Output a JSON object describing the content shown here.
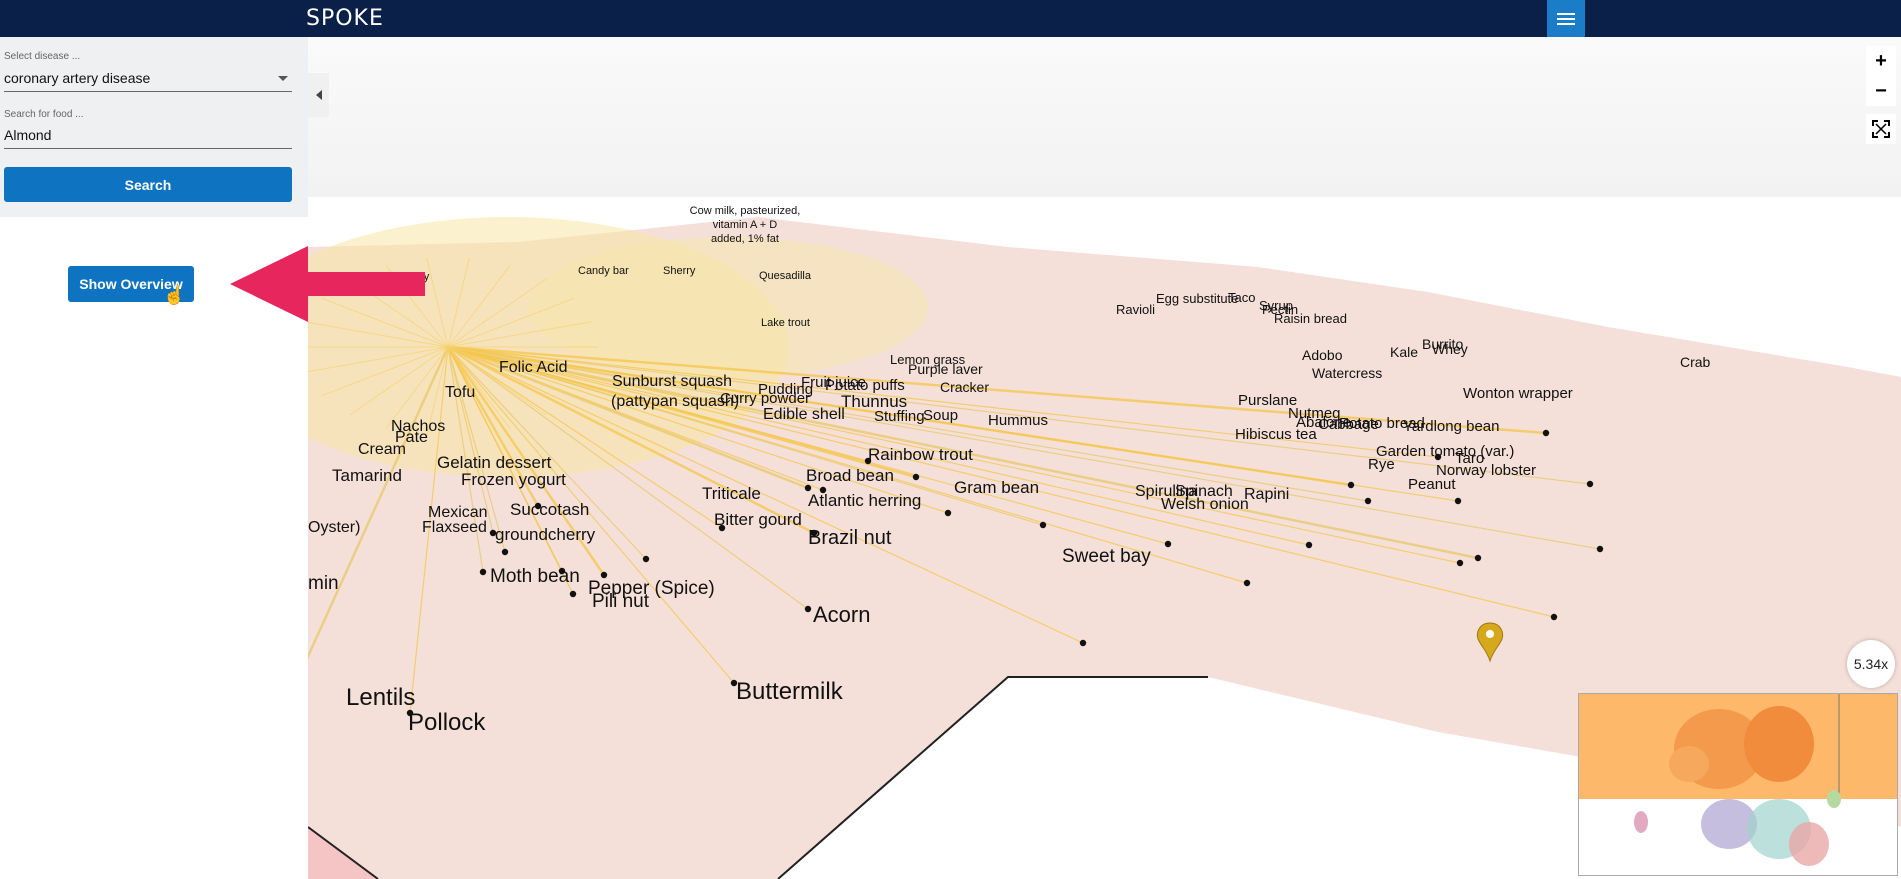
{
  "app": {
    "logo_text": "SPOKE"
  },
  "topbar": {
    "menu_icon": "hamburger-icon"
  },
  "sidebar": {
    "disease_label": "Select disease ...",
    "disease_value": "coronary artery disease",
    "food_label": "Search for food ...",
    "food_value": "Almond",
    "search_button": "Search",
    "overview_button": "Show Overview"
  },
  "map": {
    "zoom_in": "+",
    "zoom_out": "−",
    "zoom_level": "5.34x",
    "top_label_lines": [
      "Cow milk, pasteurized,",
      "vitamin A + D",
      "added, 1% fat"
    ],
    "large_labels": [
      "Lentils",
      "Pollock",
      "Buttermilk",
      "Acorn",
      "Brazil nut",
      "Sweet bay",
      "Moth bean",
      "Pepper (Spice)",
      "Pili nut",
      "groundcherry",
      "Bitter gourd",
      "Atlantic herring",
      "Broad bean",
      "Gram bean",
      "Spirulina",
      "Spinach",
      "Welsh onion",
      "Rapini",
      "Edible shell",
      "Fruit juice",
      "Stuffing",
      "Soup",
      "Hummus",
      "Purslane",
      "Abalone",
      "Cabbage",
      "Yardlong bean",
      "Wonton wrapper",
      "Crab",
      "Taro",
      "Norway lobster",
      "Peanut",
      "Rye",
      "Garden tomato (var.)",
      "Hibiscus tea",
      "Nutmeg",
      "Potato bread",
      "Whey",
      "Raisin bread",
      "Pectin",
      "Taco",
      "Ravioli",
      "Egg substitute",
      "Syrup",
      "Burrito",
      "Kale",
      "Watercress",
      "Adobo",
      "Triticale",
      "Rainbow trout",
      "Thunnus",
      "Potato puffs",
      "Pudding",
      "Curry powder",
      "Folic Acid",
      "Sunburst squash",
      "(pattypan squash)",
      "Tofu",
      "Nachos",
      "Pate",
      "Tamarind",
      "Gelatin dessert",
      "Frozen yogurt",
      "Flaxseed",
      "Succotash",
      "Mexican",
      "Oyster)",
      "Pak choy",
      "Candy bar",
      "Sherry",
      "Quesadilla",
      "Lake trout",
      "Purple laver",
      "Cracker",
      "Lemon grass",
      "Cream",
      "min"
    ],
    "pin_icon": "map-pin-icon"
  },
  "annotation": {
    "arrow_color": "#e8265e"
  },
  "colors": {
    "topbar": "#0b2049",
    "primary": "#0e73c0",
    "map_land": "#f4e0d8",
    "edge": "#f6c64a"
  }
}
